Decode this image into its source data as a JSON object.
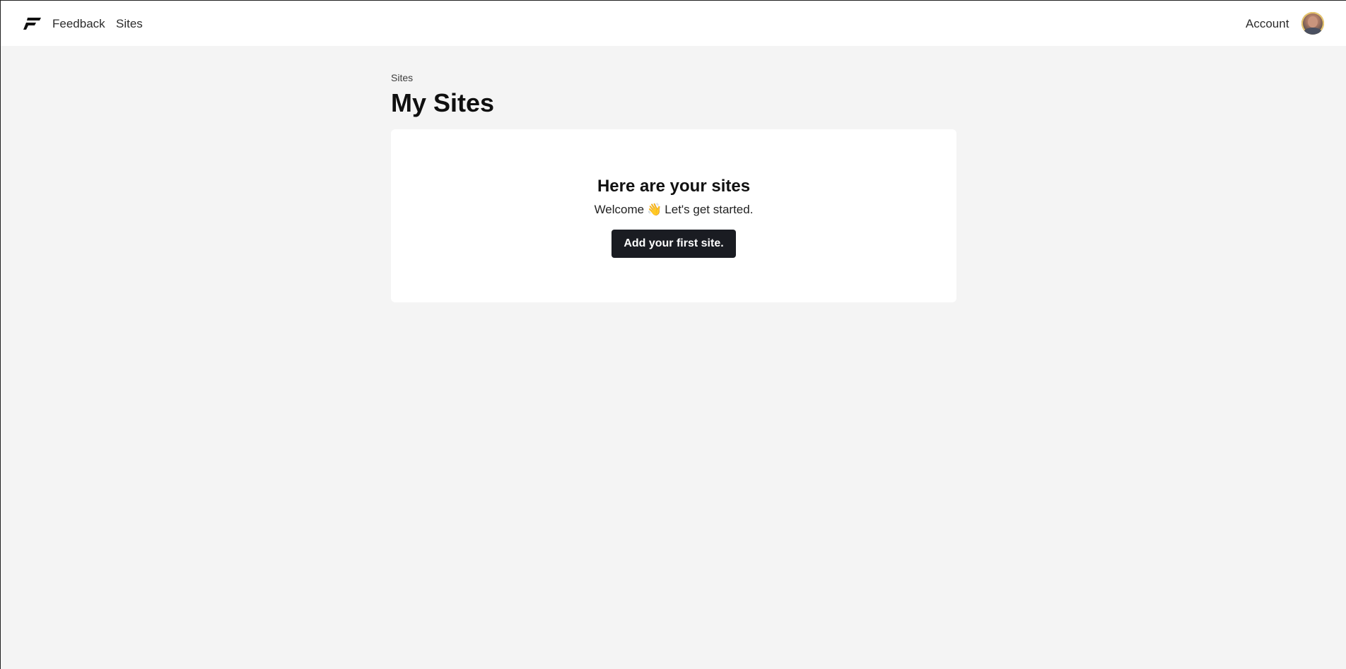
{
  "nav": {
    "logo_icon": "brand-logo-icon",
    "feedback_label": "Feedback",
    "sites_label": "Sites",
    "account_label": "Account",
    "avatar_icon": "user-avatar"
  },
  "breadcrumb": {
    "label": "Sites"
  },
  "page": {
    "title": "My Sites"
  },
  "empty_state": {
    "title": "Here are your sites",
    "welcome_text": "Welcome",
    "wave_emoji": "👋",
    "subtitle_tail": "Let's get started.",
    "cta_label": "Add your first site."
  },
  "colors": {
    "page_bg": "#f4f4f4",
    "card_bg": "#ffffff",
    "button_bg": "#1a1c22",
    "button_text": "#ffffff"
  }
}
